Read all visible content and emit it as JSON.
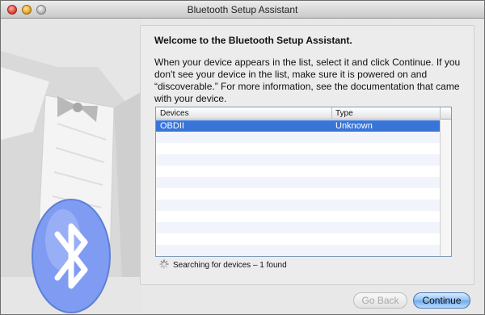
{
  "window": {
    "title": "Bluetooth Setup Assistant"
  },
  "intro": {
    "heading": "Welcome to the Bluetooth Setup Assistant.",
    "description": "When your device appears in the list, select it and click Continue. If you don't see your device in the list, make sure it is powered on and “discoverable.” For more information, see the documentation that came with your device."
  },
  "device_table": {
    "columns": [
      "Devices",
      "Type"
    ],
    "rows": [
      {
        "device": "OBDII",
        "type": "Unknown",
        "selected": true
      }
    ],
    "empty_rows": 11
  },
  "status": {
    "text": "Searching for devices – 1 found"
  },
  "buttons": {
    "back": "Go Back",
    "continue": "Continue"
  },
  "colors": {
    "selection": "#3875d7",
    "stripe": "#f1f5fb",
    "continue_button": "#6ea9ea",
    "bluetooth_badge": "#7f9cf2"
  },
  "icons": {
    "art": "tuxedo-shirt-illustration",
    "badge": "bluetooth-icon"
  }
}
